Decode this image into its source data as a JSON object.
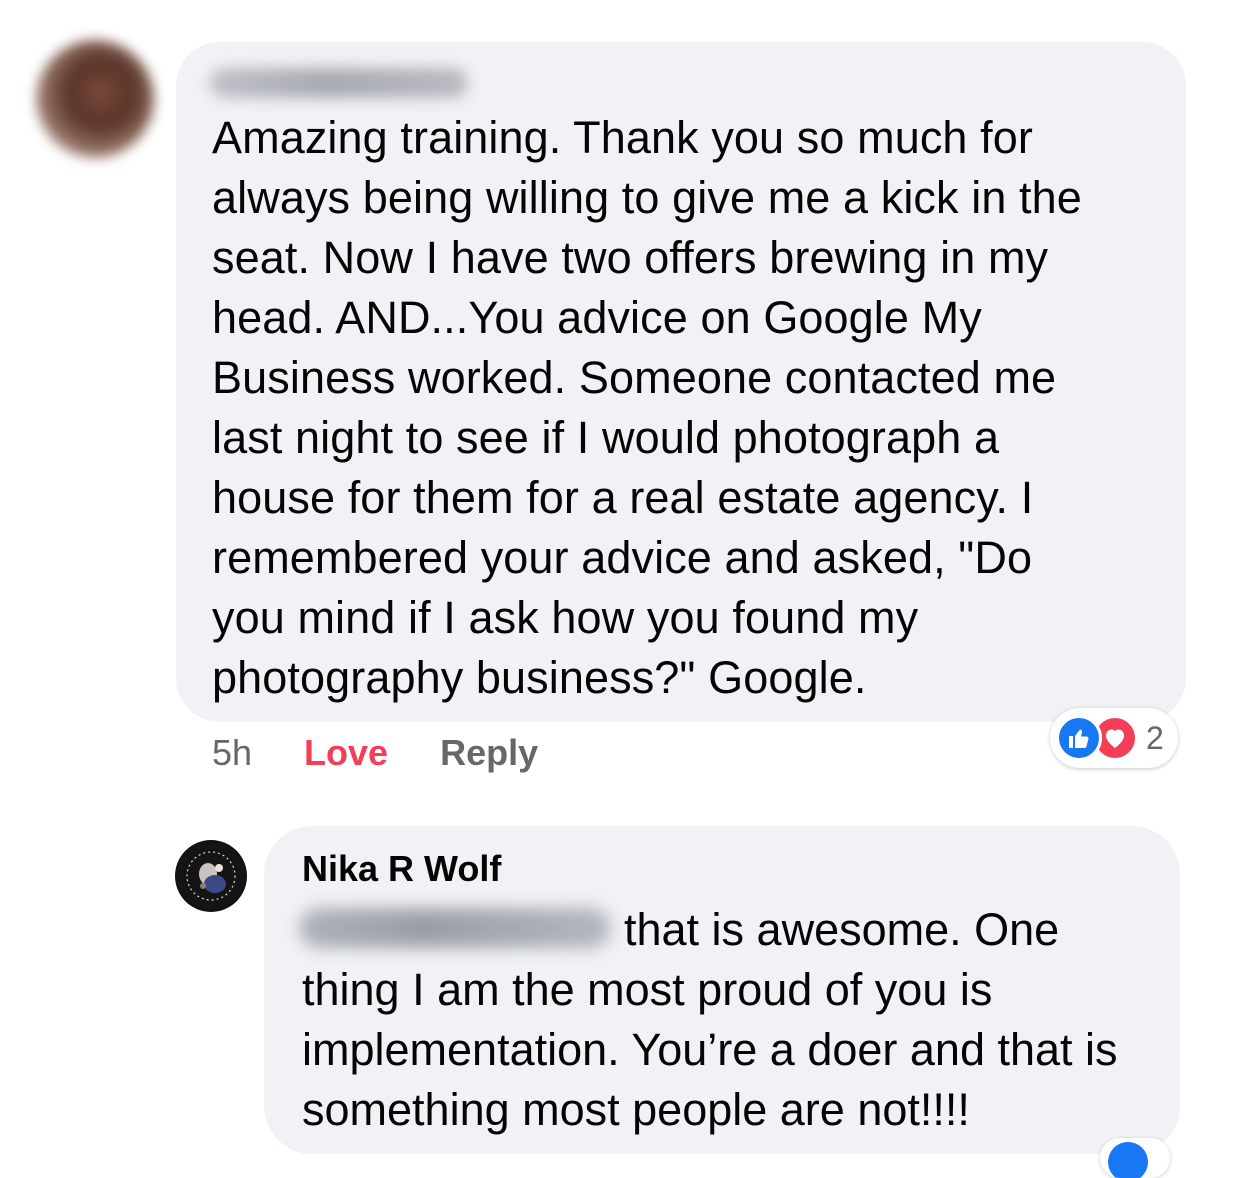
{
  "comment": {
    "text": "Amazing training.  Thank you so much for\nalways being willing to give me a kick in the\nseat.  Now I have two offers brewing in my\nhead. AND...You advice on Google My\nBusiness worked.  Someone contacted me\nlast night to see if I would photograph a\nhouse for them for a real estate agency.  I\nremembered your advice and asked, \"Do\nyou mind if I ask how you found my\nphotography business?\"  Google.",
    "time": "5h",
    "love_label": "Love",
    "reply_label": "Reply",
    "reaction_count": "2",
    "reactions": [
      "like-icon",
      "love-icon"
    ]
  },
  "reply": {
    "author": "Nika R Wolf",
    "text": "that is awesome. One thing I am the most proud of you is implementation. You’re a doer and that is something most people are not!!!!"
  },
  "colors": {
    "bubble": "#f0f2f5",
    "love": "#f33e58",
    "like": "#1877f2",
    "secondary_text": "#65676b"
  }
}
